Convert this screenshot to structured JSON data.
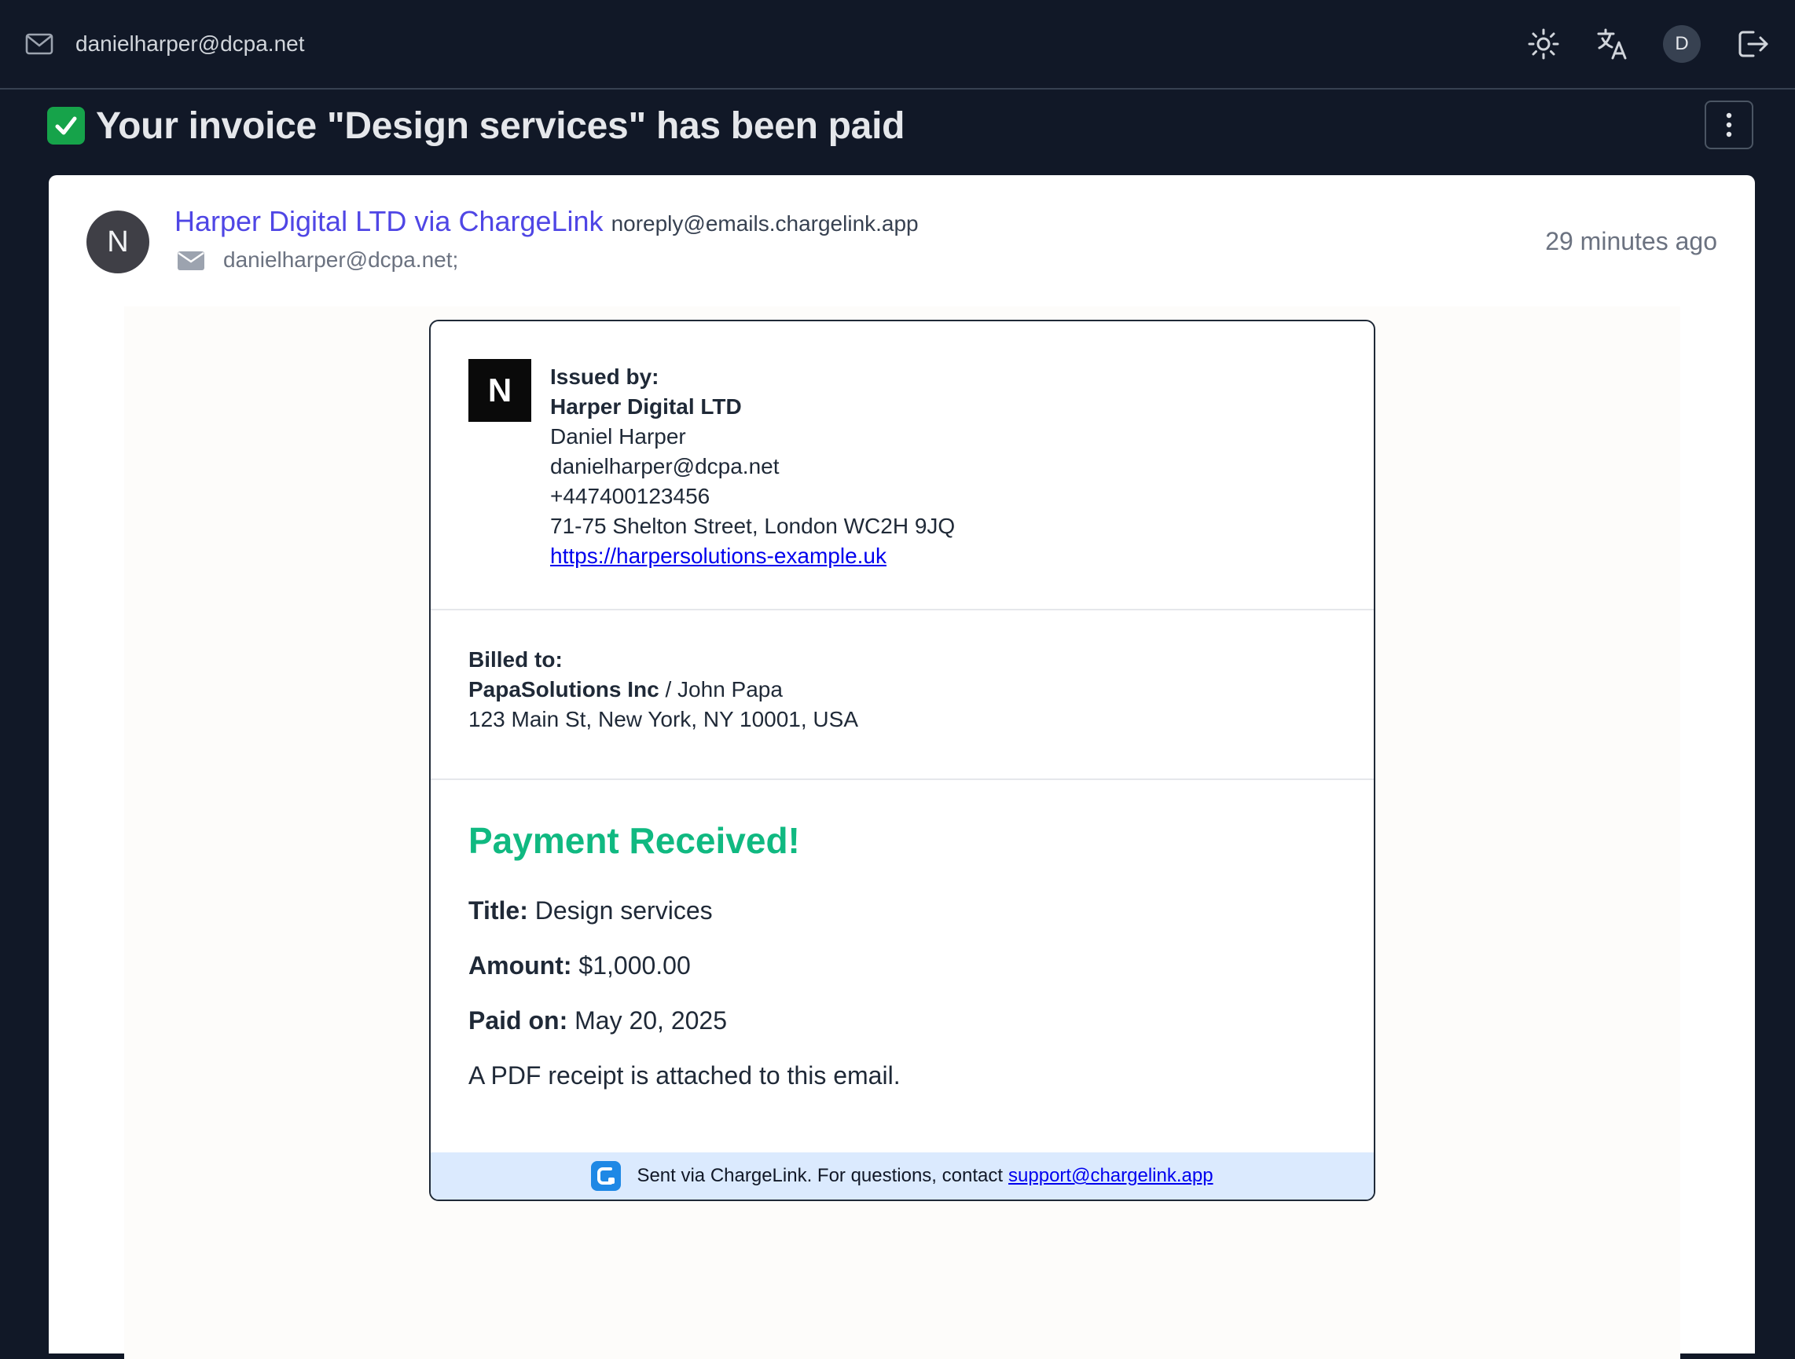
{
  "topbar": {
    "account_email": "danielharper@dcpa.net",
    "avatar_initial": "D",
    "icons": [
      "mail-icon",
      "sun-icon",
      "translate-icon",
      "logout-icon"
    ]
  },
  "message": {
    "subject": "Your invoice \"Design services\" has been paid",
    "sender_initial": "N",
    "sender_name": "Harper Digital LTD via ChargeLink",
    "sender_email": "noreply@emails.chargelink.app",
    "recipients": "danielharper@dcpa.net;",
    "timestamp": "29 minutes ago"
  },
  "invoice": {
    "logo_letter": "N",
    "issued_label": "Issued by:",
    "issuer_company": "Harper Digital LTD",
    "issuer_name": "Daniel Harper",
    "issuer_email": "danielharper@dcpa.net",
    "issuer_phone": "+447400123456",
    "issuer_address": "71-75 Shelton Street, London WC2H 9JQ",
    "issuer_website": "https://harpersolutions-example.uk",
    "billed_label": "Billed to:",
    "billed_company": "PapaSolutions Inc",
    "billed_separator": " / ",
    "billed_contact": "John Papa",
    "billed_address": "123 Main St, New York, NY 10001, USA",
    "payment_heading": "Payment Received!",
    "title_label": "Title:",
    "title_value": "Design services",
    "amount_label": "Amount:",
    "amount_value": "$1,000.00",
    "paid_label": "Paid on:",
    "paid_value": "May 20, 2025",
    "attachment_note": "A PDF receipt is attached to this email.",
    "footer_text": "Sent via ChargeLink. For questions, contact",
    "footer_link": "support@chargelink.app"
  },
  "colors": {
    "background": "#111827",
    "sender_link": "#4f46e5",
    "success": "#10b981",
    "footer_bg": "#dbeafe"
  }
}
